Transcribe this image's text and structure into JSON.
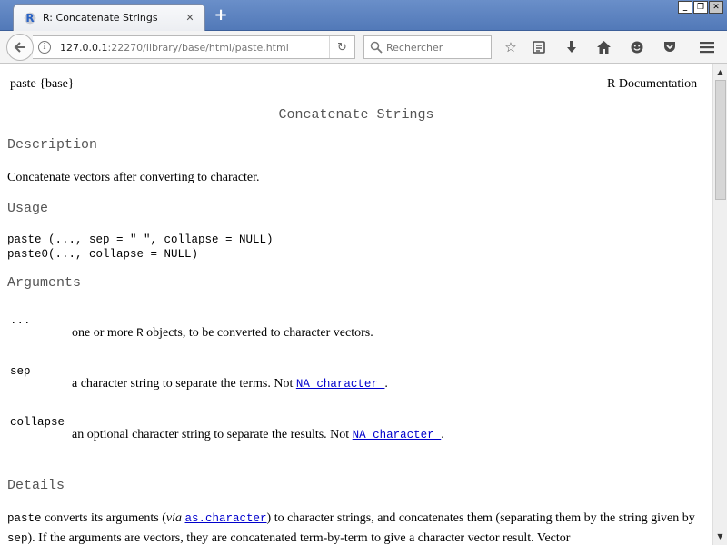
{
  "browser": {
    "tab_title": "R: Concatenate Strings",
    "tab_favicon_letter": "R",
    "url_host": "127.0.0.1",
    "url_rest": ":22270/library/base/html/paste.html",
    "search_placeholder": "Rechercher"
  },
  "doc": {
    "header_left": "paste {base}",
    "header_right": "R Documentation",
    "title": "Concatenate Strings",
    "description_heading": "Description",
    "description_text": "Concatenate vectors after converting to character.",
    "usage_heading": "Usage",
    "usage_line1": "paste (..., sep = \" \", collapse = NULL)",
    "usage_line2": "paste0(..., collapse = NULL)",
    "arguments_heading": "Arguments",
    "args": [
      {
        "name": "...",
        "desc_before": "one or more ",
        "desc_r": "R",
        "desc_after": " objects, to be converted to character vectors."
      },
      {
        "name": "sep",
        "desc_before": "a character string to separate the terms. Not ",
        "desc_link": "NA_character_",
        "desc_after": "."
      },
      {
        "name": "collapse",
        "desc_before": "an optional character string to separate the results. Not ",
        "desc_link": "NA_character_",
        "desc_after": "."
      }
    ],
    "details_heading": "Details",
    "details": {
      "code1": "paste",
      "t1": " converts its arguments (",
      "em1": "via",
      "t2": " ",
      "link1": "as.character",
      "t3": ") to character strings, and concatenates them (separating them by the string given by ",
      "code2": "sep",
      "t4": "). If the arguments are vectors, they are concatenated term-by-term to give a character vector result. Vector"
    }
  }
}
